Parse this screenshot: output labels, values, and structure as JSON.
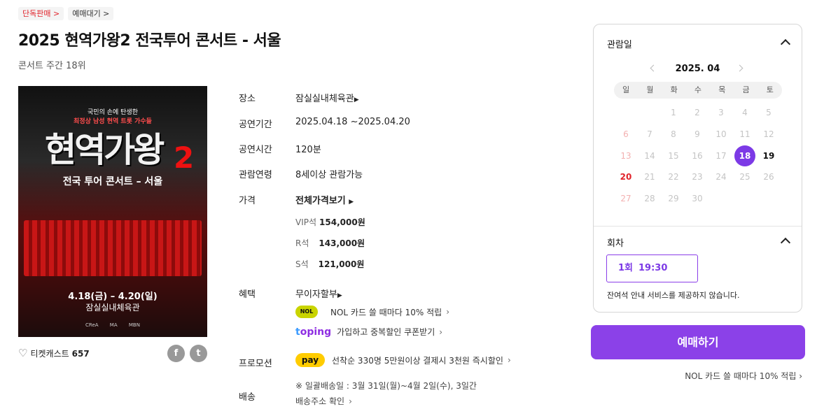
{
  "badges": {
    "exclusive": "단독판매 >",
    "waiting": "예매대기 >"
  },
  "title": "2025 현역가왕2 전국투어 콘서트 - 서울",
  "rank": "콘서트 주간 18위",
  "poster": {
    "top_line1": "국민의 손에 탄생한",
    "top_line2": "최정상 남성 현역 트롯 가수들",
    "main_title": "현역가왕",
    "main_number": "2",
    "subtitle": "전국 투어 콘서트 – 서울",
    "date": "4.18(금) – 4.20(일)",
    "venue": "잠실실내체육관",
    "sponsors": "CReA MA MBN"
  },
  "ticketcast": {
    "label": "티켓캐스트",
    "count": "657"
  },
  "social": {
    "facebook": "f",
    "twitter": "t"
  },
  "info": {
    "venue_label": "장소",
    "venue_value": "잠실실내체육관",
    "period_label": "공연기간",
    "period_value": "2025.04.18 ~2025.04.20",
    "duration_label": "공연시간",
    "duration_value": "120분",
    "age_label": "관람연령",
    "age_value": "8세이상 관람가능",
    "price_label": "가격",
    "price_value": "전체가격보기",
    "prices": [
      {
        "grade": "VIP석",
        "amount": "154,000원"
      },
      {
        "grade": "R석",
        "amount": "143,000원"
      },
      {
        "grade": "S석",
        "amount": "121,000원"
      }
    ],
    "benefit_label": "혜택",
    "benefit_value": "무이자할부",
    "benefit_nol": "NOL 카드 쓸 때마다 10% 적립",
    "benefit_toping": "가입하고 중복할인 쿠폰받기",
    "promo_label": "프로모션",
    "promo_text": "선착순 330명 5만원이상 결제시 3천원 즉시할인",
    "delivery_label": "배송",
    "delivery_note": "※ 일괄배송일 : 3월 31일(월)~4월 2일(수), 3일간",
    "delivery_link": "배송주소 확인"
  },
  "logos": {
    "nol": "NOL",
    "toping_t": "t",
    "toping_rest": "oping",
    "kpay": "pay"
  },
  "calendar": {
    "section_label": "관람일",
    "month": "2025. 04",
    "weekdays": [
      "일",
      "월",
      "화",
      "수",
      "목",
      "금",
      "토"
    ],
    "days": [
      "1",
      "2",
      "3",
      "4",
      "5",
      "6",
      "7",
      "8",
      "9",
      "10",
      "11",
      "12",
      "13",
      "14",
      "15",
      "16",
      "17",
      "18",
      "19",
      "20",
      "21",
      "22",
      "23",
      "24",
      "25",
      "26",
      "27",
      "28",
      "29",
      "30"
    ],
    "first_weekday": 2,
    "selected_day": 18,
    "available_days": [
      18,
      19,
      20
    ]
  },
  "session": {
    "section_label": "회차",
    "round": "1회",
    "time": "19:30",
    "note": "잔여석 안내 서비스를 제공하지 않습니다."
  },
  "booking": {
    "button_label": "예매하기",
    "promo": "NOL 카드 쓸 때마다 10% 적립 ›"
  }
}
